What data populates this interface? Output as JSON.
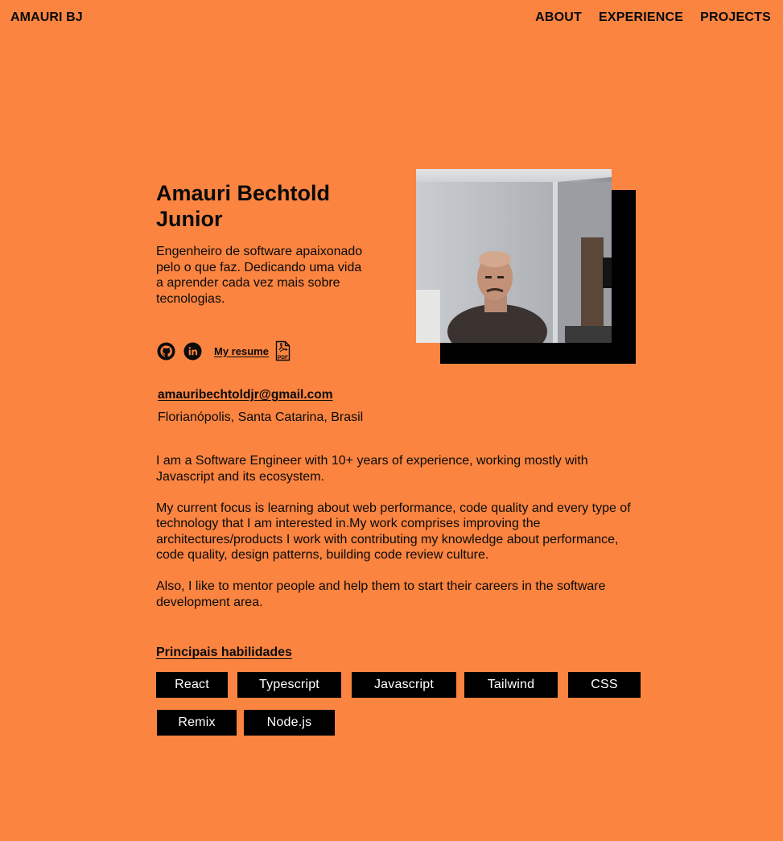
{
  "nav": {
    "brand": "AMAURI BJ",
    "links": [
      "ABOUT",
      "EXPERIENCE",
      "PROJECTS"
    ]
  },
  "hero": {
    "name": "Amauri Bechtold Junior",
    "tagline": "Engenheiro de software apaixonado pelo o que faz. Dedicando uma vida a aprender cada vez mais sobre tecnologias.",
    "social_icons": [
      "github-icon",
      "linkedin-icon"
    ],
    "resume_label": "My resume",
    "resume_icon": "pdf-icon"
  },
  "contact": {
    "email": "amauribechtoldjr@gmail.com",
    "location": "Florianópolis, Santa Catarina, Brasil"
  },
  "about": {
    "paragraphs": [
      "I am a Software Engineer with 10+ years of experience, working mostly with Javascript and its ecosystem.",
      "My current focus is learning about web performance, code quality and every type of technology that I am interested in.My work comprises improving the architectures/products I work with contributing my knowledge about performance, code quality, design patterns, building code review culture.",
      "Also, I like to mentor people and help them to start their careers in the software development area."
    ]
  },
  "skills": {
    "title": "Principais habilidades",
    "items": [
      "React",
      "Typescript",
      "Javascript",
      "Tailwind",
      "CSS",
      "Remix",
      "Node.js"
    ]
  },
  "colors": {
    "background": "#fb8440",
    "ink": "#0a0a0a",
    "chip": "#000000"
  }
}
